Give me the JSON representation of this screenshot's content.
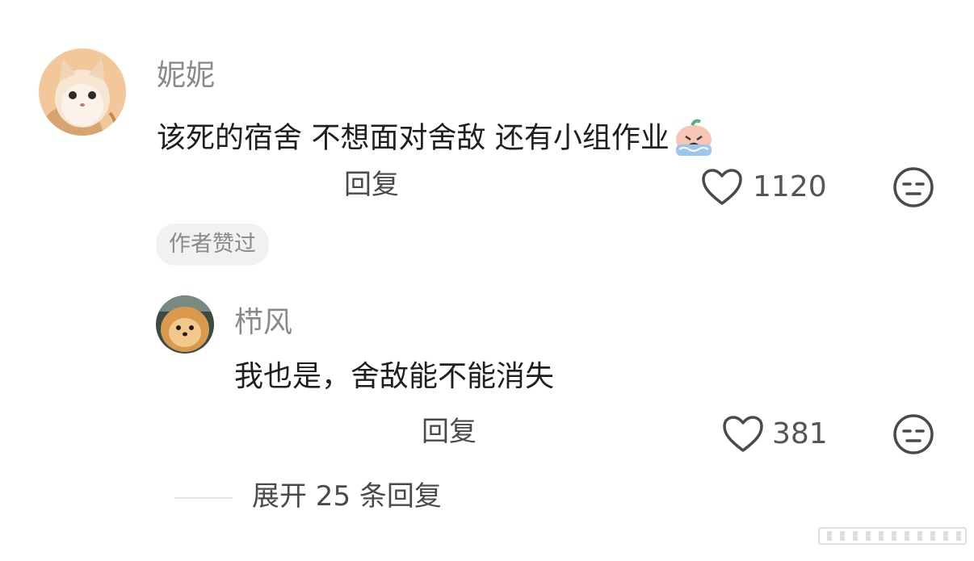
{
  "comments": [
    {
      "username": "妮妮",
      "text": "该死的宿舍 不想面对舍敌 还有小组作业",
      "emoji": "crying-emoji",
      "reply_label": "回复",
      "likes": "1120",
      "author_badge": "作者赞过"
    },
    {
      "username": "栉风",
      "text": "我也是，舍敌能不能消失",
      "reply_label": "回复",
      "likes": "381"
    }
  ],
  "expand_replies": "展开 25 条回复",
  "icons": {
    "like": "heart-outline-icon",
    "dislike": "meh-face-icon"
  },
  "colors": {
    "username": "#8a8a8a",
    "text": "#1f1f1f",
    "badge_bg": "#f1f1f1"
  }
}
